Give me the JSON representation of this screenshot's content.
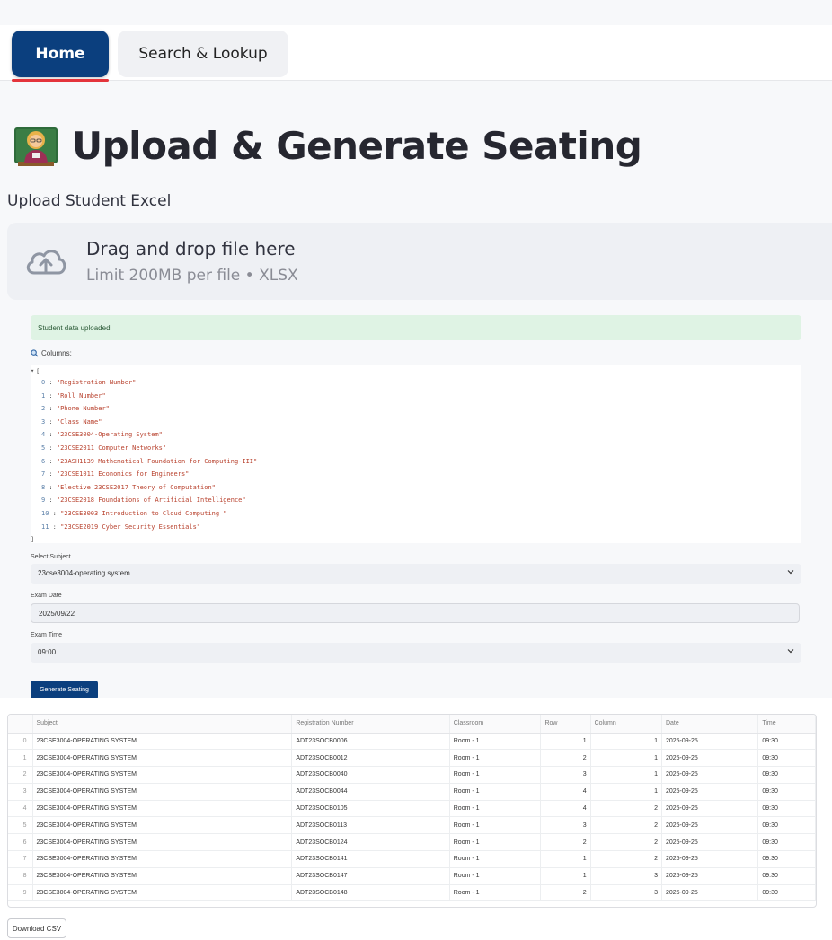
{
  "nav": {
    "tabs": [
      {
        "label": "Home",
        "active": true
      },
      {
        "label": "Search & Lookup",
        "active": false
      }
    ]
  },
  "page": {
    "title": "Upload & Generate Seating",
    "title_icon": "teacher-emoji"
  },
  "upload": {
    "label": "Upload Student Excel",
    "drop_text": "Drag and drop file here",
    "limit_text": "Limit 200MB per file • XLSX",
    "icon": "cloud-upload-icon"
  },
  "status": {
    "success_message": "Student data uploaded."
  },
  "columns": {
    "label": "Columns:",
    "icon": "magnifier-icon",
    "open_bracket": "[",
    "close_bracket": "]",
    "items": [
      {
        "index": "0",
        "value": "\"Registration Number\""
      },
      {
        "index": "1",
        "value": "\"Roll Number\""
      },
      {
        "index": "2",
        "value": "\"Phone Number\""
      },
      {
        "index": "3",
        "value": "\"Class Name\""
      },
      {
        "index": "4",
        "value": "\"23CSE3004-Operating System\""
      },
      {
        "index": "5",
        "value": "\"23CSE2011 Computer Networks\""
      },
      {
        "index": "6",
        "value": "\"23ASH1139 Mathematical Foundation for Computing-III\""
      },
      {
        "index": "7",
        "value": "\"23CSE1011 Economics for Engineers\""
      },
      {
        "index": "8",
        "value": "\"Elective 23CSE2017 Theory of Computation\""
      },
      {
        "index": "9",
        "value": "\"23CSE2018 Foundations of Artificial Intelligence\""
      },
      {
        "index": "10",
        "value": "\"23CSE3003 Introduction to Cloud Computing \""
      },
      {
        "index": "11",
        "value": "\"23CSE2019 Cyber Security Essentials\""
      }
    ]
  },
  "form": {
    "subject_label": "Select Subject",
    "subject_value": "23cse3004-operating system",
    "date_label": "Exam Date",
    "date_value": "2025/09/22",
    "time_label": "Exam Time",
    "time_value": "09:00",
    "generate_label": "Generate Seating"
  },
  "table": {
    "headers": [
      "",
      "Subject",
      "Registration Number",
      "Classroom",
      "Row",
      "Column",
      "Date",
      "Time"
    ],
    "rows": [
      [
        "0",
        "23CSE3004-OPERATING SYSTEM",
        "ADT23SOCB0006",
        "Room - 1",
        "1",
        "1",
        "2025-09-25",
        "09:30"
      ],
      [
        "1",
        "23CSE3004-OPERATING SYSTEM",
        "ADT23SOCB0012",
        "Room - 1",
        "2",
        "1",
        "2025-09-25",
        "09:30"
      ],
      [
        "2",
        "23CSE3004-OPERATING SYSTEM",
        "ADT23SOCB0040",
        "Room - 1",
        "3",
        "1",
        "2025-09-25",
        "09:30"
      ],
      [
        "3",
        "23CSE3004-OPERATING SYSTEM",
        "ADT23SOCB0044",
        "Room - 1",
        "4",
        "1",
        "2025-09-25",
        "09:30"
      ],
      [
        "4",
        "23CSE3004-OPERATING SYSTEM",
        "ADT23SOCB0105",
        "Room - 1",
        "4",
        "2",
        "2025-09-25",
        "09:30"
      ],
      [
        "5",
        "23CSE3004-OPERATING SYSTEM",
        "ADT23SOCB0113",
        "Room - 1",
        "3",
        "2",
        "2025-09-25",
        "09:30"
      ],
      [
        "6",
        "23CSE3004-OPERATING SYSTEM",
        "ADT23SOCB0124",
        "Room - 1",
        "2",
        "2",
        "2025-09-25",
        "09:30"
      ],
      [
        "7",
        "23CSE3004-OPERATING SYSTEM",
        "ADT23SOCB0141",
        "Room - 1",
        "1",
        "2",
        "2025-09-25",
        "09:30"
      ],
      [
        "8",
        "23CSE3004-OPERATING SYSTEM",
        "ADT23SOCB0147",
        "Room - 1",
        "1",
        "3",
        "2025-09-25",
        "09:30"
      ],
      [
        "9",
        "23CSE3004-OPERATING SYSTEM",
        "ADT23SOCB0148",
        "Room - 1",
        "2",
        "3",
        "2025-09-25",
        "09:30"
      ]
    ]
  },
  "actions": {
    "download_label": "Download CSV"
  },
  "colors": {
    "primary": "#0b3f7e",
    "active_underline": "#e4343b",
    "success_bg": "#dff3e4",
    "json_string": "#b8412d",
    "json_index": "#5a7fa8"
  }
}
